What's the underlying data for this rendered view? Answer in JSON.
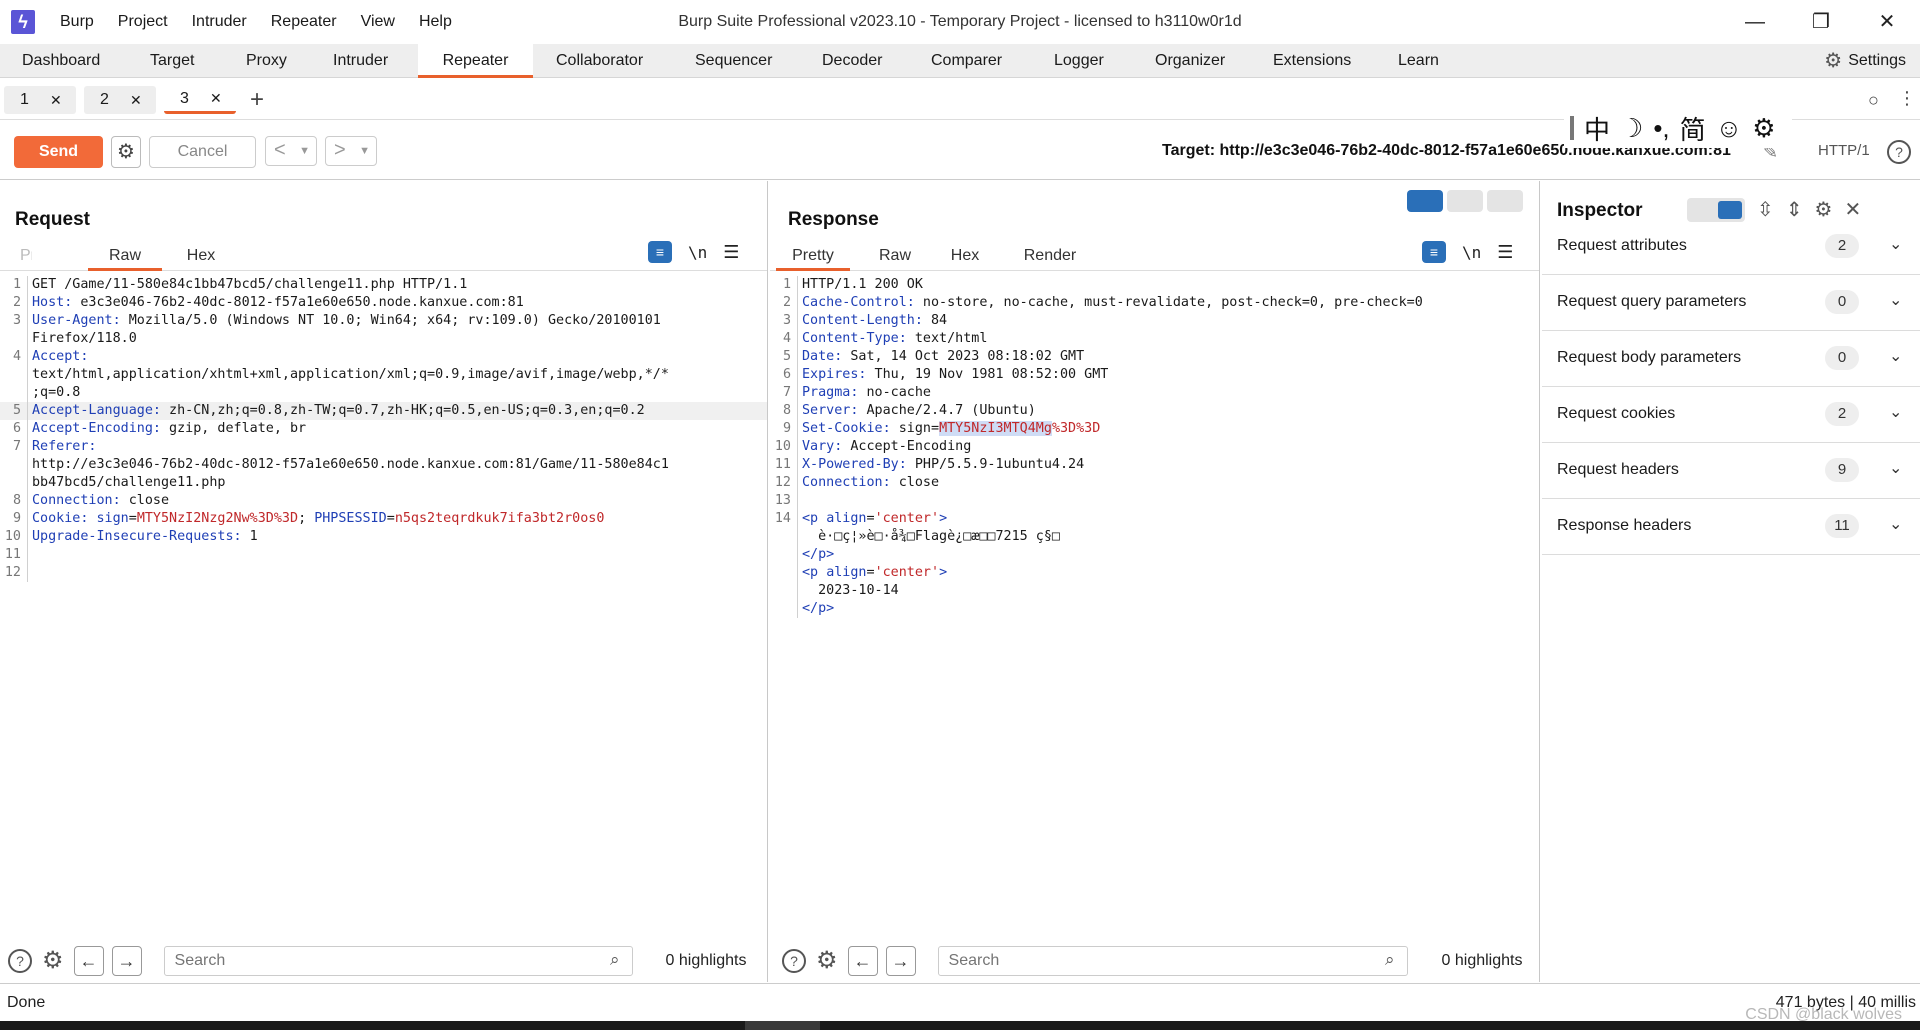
{
  "app": {
    "title": "Burp Suite Professional v2023.10 - Temporary Project - licensed to h3110w0r1d",
    "menu": [
      "Burp",
      "Project",
      "Intruder",
      "Repeater",
      "View",
      "Help"
    ]
  },
  "tooltabs": {
    "items": [
      "Dashboard",
      "Target",
      "Proxy",
      "Intruder",
      "Repeater",
      "Collaborator",
      "Sequencer",
      "Decoder",
      "Comparer",
      "Logger",
      "Organizer",
      "Extensions",
      "Learn"
    ],
    "active": "Repeater",
    "settings_label": "Settings"
  },
  "repeater_tabs": {
    "items": [
      {
        "label": "1"
      },
      {
        "label": "2"
      },
      {
        "label": "3"
      }
    ],
    "active": "3"
  },
  "toolbar": {
    "send_label": "Send",
    "cancel_label": "Cancel",
    "target_label": "Target: http://e3c3e046-76b2-40dc-8012-f57a1e60e650.node.kanxue.com:81",
    "http_version": "HTTP/1"
  },
  "ime": {
    "chars": [
      "中",
      "☽",
      "•,",
      "简",
      "☺",
      "⚙"
    ]
  },
  "request": {
    "title": "Request",
    "tabs": [
      "Pretty",
      "Raw",
      "Hex"
    ],
    "active_tab": "Raw",
    "search_placeholder": "Search",
    "highlights": "0 highlights"
  },
  "response": {
    "title": "Response",
    "tabs": [
      "Pretty",
      "Raw",
      "Hex",
      "Render"
    ],
    "active_tab": "Pretty",
    "search_placeholder": "Search",
    "highlights": "0 highlights"
  },
  "inspector": {
    "title": "Inspector",
    "sections": [
      {
        "label": "Request attributes",
        "count": "2"
      },
      {
        "label": "Request query parameters",
        "count": "0"
      },
      {
        "label": "Request body parameters",
        "count": "0"
      },
      {
        "label": "Request cookies",
        "count": "2"
      },
      {
        "label": "Request headers",
        "count": "9"
      },
      {
        "label": "Response headers",
        "count": "11"
      }
    ]
  },
  "status": {
    "left": "Done",
    "right": "471 bytes | 40 millis",
    "watermark": "CSDN @black wolves"
  },
  "colors": {
    "accent": "#e8602c",
    "send": "#f26a39",
    "header_name": "#1f3fb5",
    "cookie_value": "#c0282a",
    "toggle_on": "#2a6fb8"
  }
}
